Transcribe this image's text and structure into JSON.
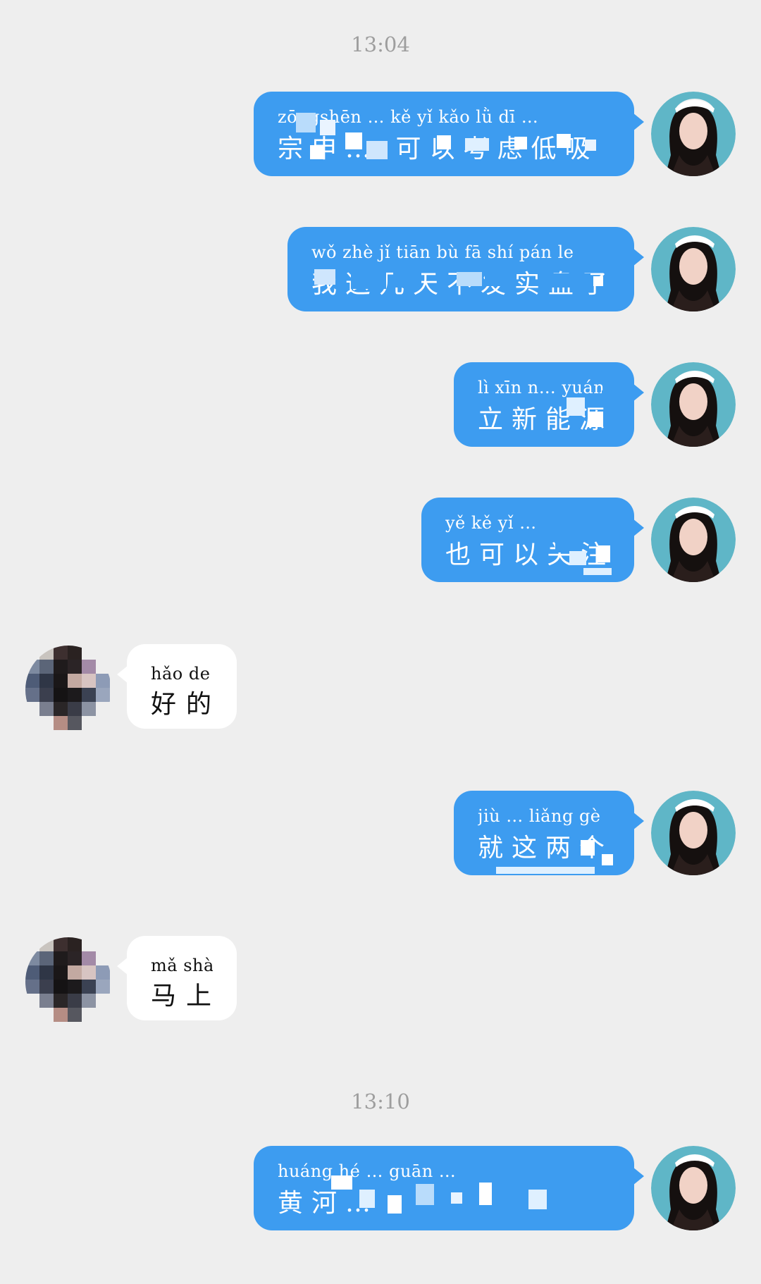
{
  "timestamps": [
    "13:04",
    "13:10"
  ],
  "messages": [
    {
      "side": "out",
      "pinyin": "zōngshēn … kě yǐ kǎo lǜ dī …",
      "hanzi": "宗申… 可以考虑低吸"
    },
    {
      "side": "out",
      "pinyin": "wǒ zhè jǐ tiān bù fā shí pán le",
      "hanzi": "我这几天不发实盘了"
    },
    {
      "side": "out",
      "pinyin": "lì xīn n… yuán",
      "hanzi": "立新能源"
    },
    {
      "side": "out",
      "pinyin": "yě kě yǐ …",
      "hanzi": "也可以关注"
    },
    {
      "side": "in",
      "pinyin": "hǎo de",
      "hanzi": "好的"
    },
    {
      "side": "out",
      "pinyin": "jiù … liǎng gè",
      "hanzi": "就这两个"
    },
    {
      "side": "in",
      "pinyin": "mǎ shàng",
      "hanzi": "马上"
    },
    {
      "side": "out",
      "pinyin": "huáng hé … guān …",
      "hanzi": "黄河…"
    }
  ],
  "avatars": {
    "self": "illustrated-girl-avatar-icon",
    "other": "pixelated-photo-avatar-icon"
  },
  "colors": {
    "background": "#eeeeee",
    "outgoing_bubble": "#3d9cf0",
    "incoming_bubble": "#ffffff",
    "timestamp_text": "#9e9e9e"
  }
}
